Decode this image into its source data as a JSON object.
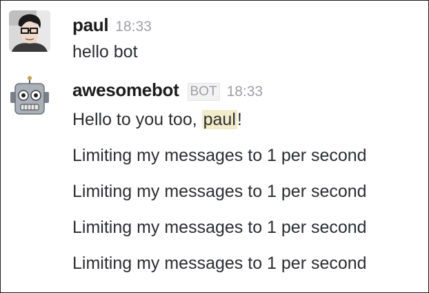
{
  "messages": [
    {
      "username": "paul",
      "timestamp": "18:33",
      "avatar": "user-photo-avatar",
      "lines": [
        "hello bot"
      ]
    },
    {
      "username": "awesomebot",
      "badge": "BOT",
      "timestamp": "18:33",
      "avatar": "robot-avatar",
      "greeting": {
        "prefix": "Hello to you too, ",
        "mention": "paul",
        "suffix": "!"
      },
      "lines": [
        "Limiting my messages to 1 per second",
        "Limiting my messages to 1 per second",
        "Limiting my messages to 1 per second",
        "Limiting my messages to 1 per second"
      ]
    }
  ],
  "colors": {
    "mention_highlight": "#f2eccb",
    "timestamp": "#9e9ea6",
    "text": "#2c2d30"
  }
}
